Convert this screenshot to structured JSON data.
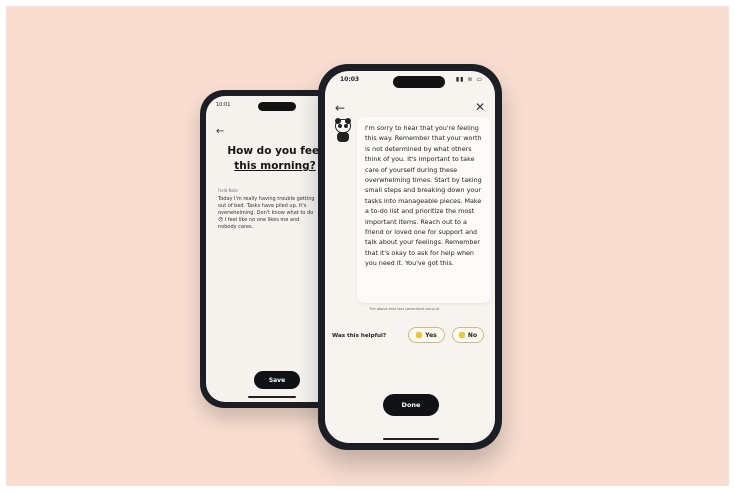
{
  "back_screen": {
    "status_time": "10:01",
    "title_line1": "How do you feel",
    "title_line2": "this morning?",
    "field_label": "Field Note",
    "entry_text": "Today I'm really having trouble getting\nout of bed. Tasks have piled up. It's\noverwhelming. Don't know what to do\n😞 I feel like no one likes me and\nnobody cares.",
    "save_label": "Save"
  },
  "front_screen": {
    "status_time": "10:03",
    "status_icons": "▮▮ ≋ ▭",
    "back_icon": "←",
    "close_icon": "✕",
    "response_text": "I'm sorry to hear that you're feeling this way. Remember that your worth is not determined by what others think of you. It's important to take care of yourself during these overwhelming times. Start by taking small steps and breaking down your tasks into manageable pieces. Make a to-do list and prioritize the most important items. Reach out to a friend or loved one for support and talk about your feelings. Remember that it's okay to ask for help when you need it. You've got this.",
    "disclaimer": "The above text was generated using AI",
    "helpful_label": "Was this helpful?",
    "yes_label": "Yes",
    "no_label": "No",
    "done_label": "Done"
  },
  "colors": {
    "background": "#f8ddd0",
    "phone_frame": "#1b1e25",
    "screen": "#f7f4ef",
    "button_dark": "#101216",
    "chip_border": "#cbb98e"
  }
}
